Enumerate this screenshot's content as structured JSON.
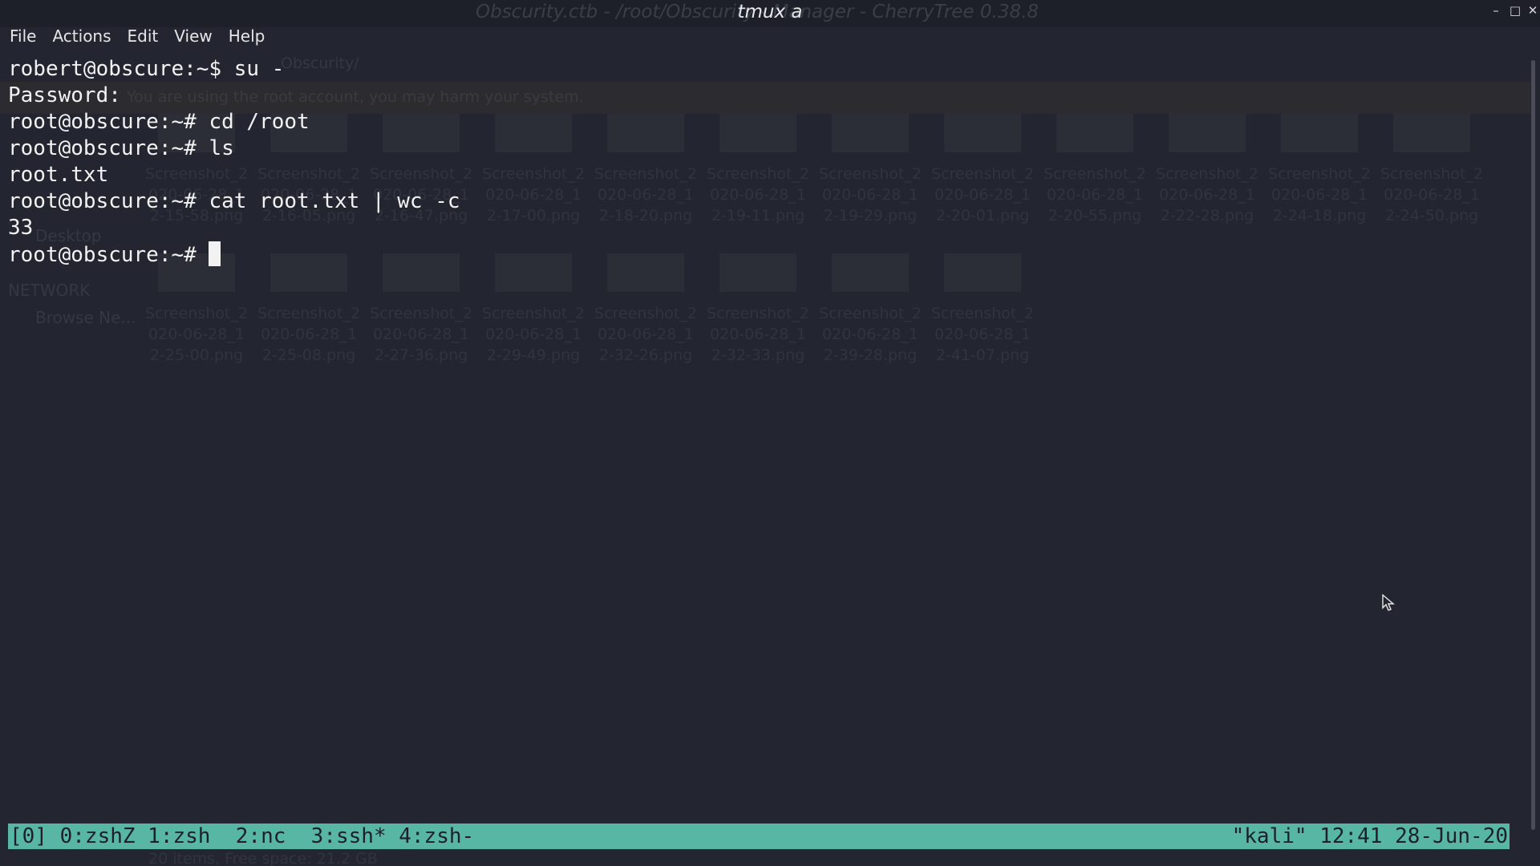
{
  "window": {
    "title": "tmux a",
    "background_title": "Obscurity.ctb - /root/Obscurity - Manager - CherryTree 0.38.8",
    "controls": [
      "minimize-icon",
      "maximize-icon",
      "close-icon"
    ]
  },
  "menubar": {
    "items": [
      "File",
      "Actions",
      "Edit",
      "View",
      "Help"
    ]
  },
  "background_app": {
    "path": "Obscurity/",
    "warning": "You are using the root account, you may harm your system.",
    "sidebar": {
      "desktop": "Desktop",
      "network_heading": "NETWORK",
      "browse": "Browse Ne..."
    },
    "files": [
      "Screenshot_2020-06-28_12-15-58.png",
      "Screenshot_2020-06-28_12-16-05.png",
      "Screenshot_2020-06-28_12-16-47.png",
      "Screenshot_2020-06-28_12-17-00.png",
      "Screenshot_2020-06-28_12-18-20.png",
      "Screenshot_2020-06-28_12-19-11.png",
      "Screenshot_2020-06-28_12-19-29.png",
      "Screenshot_2020-06-28_12-20-01.png",
      "Screenshot_2020-06-28_12-20-55.png",
      "Screenshot_2020-06-28_12-22-28.png",
      "Screenshot_2020-06-28_12-24-18.png",
      "Screenshot_2020-06-28_12-24-50.png",
      "Screenshot_2020-06-28_12-25-00.png",
      "Screenshot_2020-06-28_12-25-08.png",
      "Screenshot_2020-06-28_12-27-36.png",
      "Screenshot_2020-06-28_12-29-49.png",
      "Screenshot_2020-06-28_12-32-26.png",
      "Screenshot_2020-06-28_12-32-33.png",
      "Screenshot_2020-06-28_12-39-28.png",
      "Screenshot_2020-06-28_12-41-07.png"
    ],
    "status": "20 items, Free space: 21.2 GB"
  },
  "terminal": {
    "lines": [
      "robert@obscure:~$ su -",
      "Password:",
      "root@obscure:~# cd /root",
      "root@obscure:~# ls",
      "root.txt",
      "root@obscure:~# cat root.txt | wc -c",
      "33"
    ],
    "prompt": "root@obscure:~# "
  },
  "tmux_status": {
    "left": "[0] 0:zshZ 1:zsh  2:nc  3:ssh* 4:zsh-",
    "right": "\"kali\" 12:41 28-Jun-20"
  },
  "colors": {
    "terminal_bg": "#232630",
    "terminal_fg": "#f2f2f2",
    "status_bg": "#58b7a4",
    "status_fg": "#1d2029"
  }
}
